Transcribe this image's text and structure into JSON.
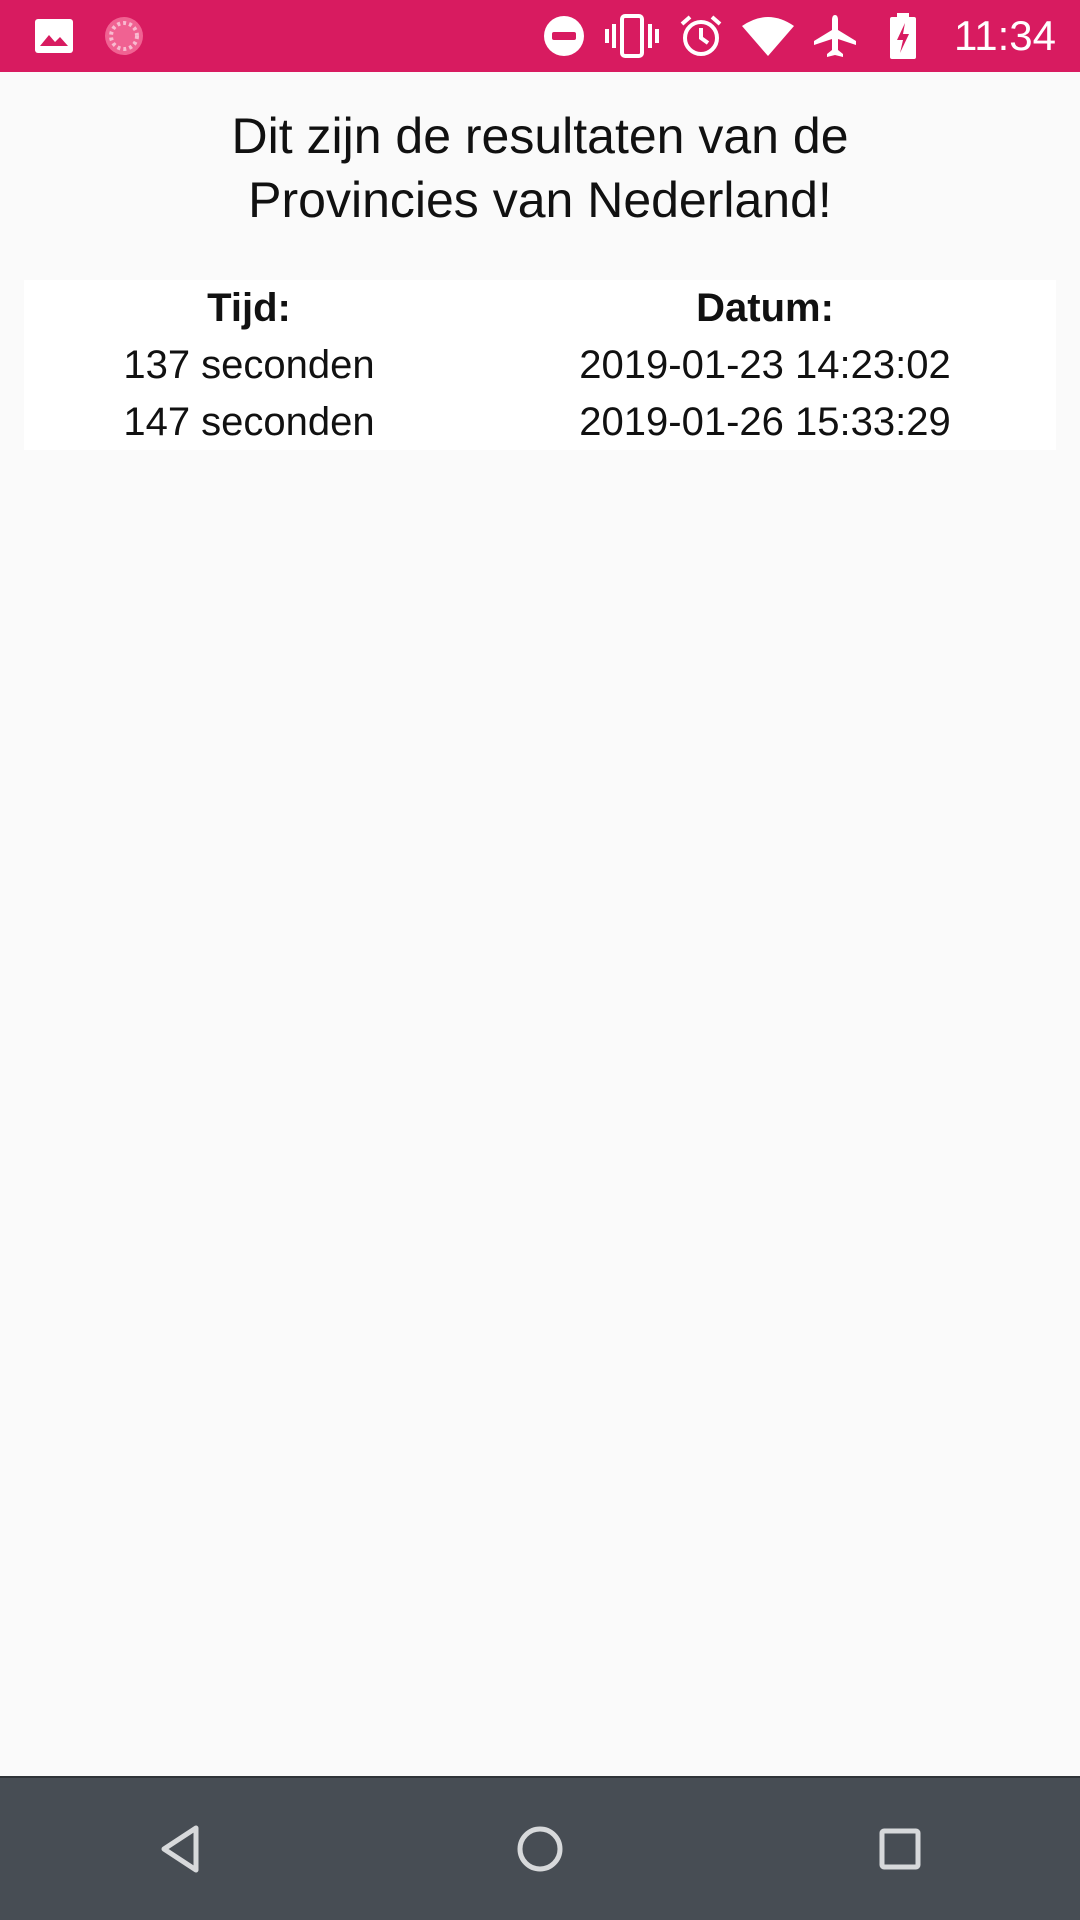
{
  "status_bar": {
    "time": "11:34",
    "color": "#d81b60",
    "icons": [
      "image-icon",
      "loading-icon",
      "do-not-disturb-icon",
      "vibrate-icon",
      "alarm-icon",
      "wifi-icon",
      "airplane-mode-icon",
      "battery-charging-icon"
    ]
  },
  "page": {
    "title_line1": "Dit zijn de resultaten van de",
    "title_line2": "Provincies van Nederland!"
  },
  "results": {
    "columns": [
      "Tijd:",
      "Datum:"
    ],
    "rows": [
      {
        "time": "137 seconden",
        "date": "2019-01-23 14:23:02"
      },
      {
        "time": "147 seconden",
        "date": "2019-01-26 15:33:29"
      }
    ]
  },
  "nav_bar": {
    "buttons": [
      "back-icon",
      "home-icon",
      "recents-icon"
    ]
  }
}
